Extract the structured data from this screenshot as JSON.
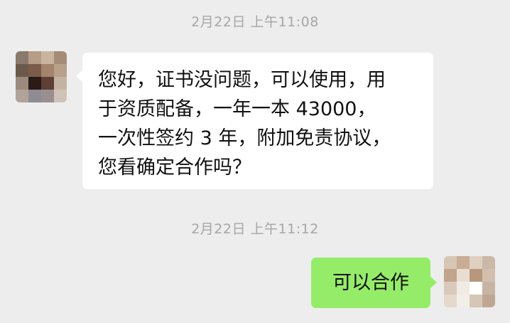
{
  "chat": {
    "messages": [
      {
        "timestamp": "2月22日 上午11:08",
        "sender": "contact",
        "avatar_icon": "blurred-avatar-icon",
        "text": "您好，证书没问题，可以使用，用\n于资质配备，一年一本 43000，\n一次性签约 3 年，附加免责协议，\n您看确定合作吗？"
      },
      {
        "timestamp": "2月22日 上午11:12",
        "sender": "me",
        "avatar_icon": "blurred-avatar-icon",
        "text": "可以合作"
      }
    ]
  },
  "colors": {
    "background": "#ededed",
    "incoming_bubble": "#ffffff",
    "outgoing_bubble": "#95ec69",
    "timestamp_text": "#a6a6a6"
  }
}
